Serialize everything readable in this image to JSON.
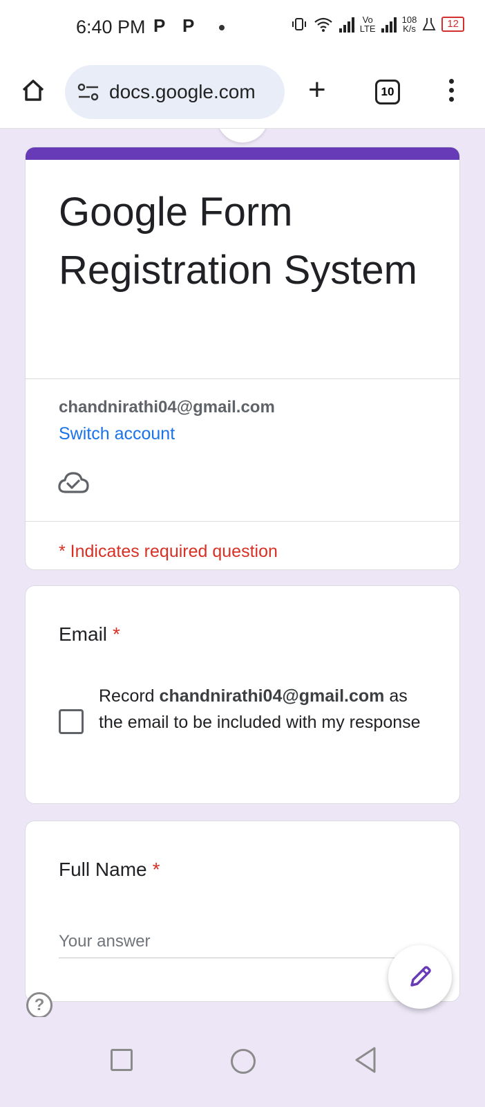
{
  "status_bar": {
    "time": "6:40 PM",
    "notif_icons": [
      "P",
      "P"
    ],
    "network_speed_top": "108",
    "network_speed_bottom": "K/s",
    "volte_top": "Vo",
    "volte_bottom": "LTE",
    "battery": "12"
  },
  "browser": {
    "url": "docs.google.com",
    "tab_count": "10",
    "new_tab_label": "+"
  },
  "form": {
    "title": "Google Form Registration System",
    "account_email": "chandnirathi04@gmail.com",
    "switch_account": "Switch account",
    "required_note": "* Indicates required question",
    "accent_color": "#673ab7"
  },
  "questions": {
    "email": {
      "label": "Email",
      "required_mark": "*",
      "checkbox_text_prefix": "Record ",
      "checkbox_text_email": "chandnirathi04@gmail.com",
      "checkbox_text_suffix": " as the email to be included with my response"
    },
    "full_name": {
      "label": "Full Name",
      "required_mark": "*",
      "placeholder": "Your answer"
    }
  },
  "icons": {
    "home": "home-icon",
    "site_settings": "tune-icon",
    "cloud_saved": "cloud-done-icon",
    "help": "help-icon",
    "edit": "pencil-icon"
  },
  "help_glyph": "?"
}
